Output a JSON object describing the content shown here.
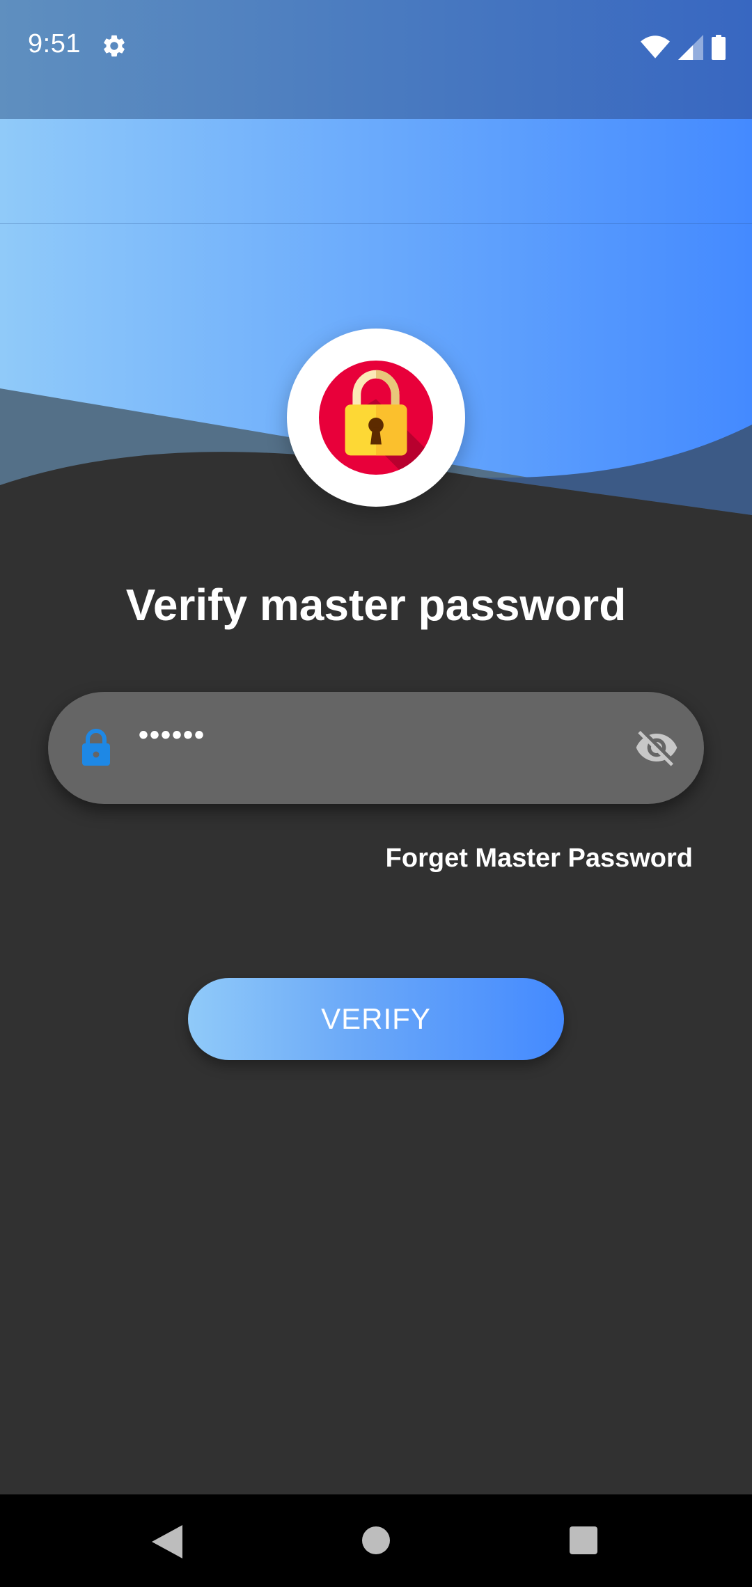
{
  "status_bar": {
    "time": "9:51",
    "icons": [
      "settings-icon",
      "wifi-icon",
      "cellular-signal-icon",
      "battery-icon"
    ]
  },
  "header": {
    "app_icon": "padlock-icon"
  },
  "main": {
    "title": "Verify master password",
    "password_field": {
      "value": "••••••",
      "leading_icon": "lock-icon",
      "trailing_icon": "visibility-off-icon"
    },
    "forgot_link": "Forget Master Password",
    "verify_button": "VERIFY"
  },
  "nav_bar": {
    "icons": [
      "back-icon",
      "home-icon",
      "recents-icon"
    ]
  },
  "colors": {
    "background": "#313131",
    "gradient_start": "#90caf9",
    "gradient_end": "#448aff",
    "field_background": "#656565",
    "lock_blue": "#1e88e5",
    "badge_red": "#e8003a"
  }
}
